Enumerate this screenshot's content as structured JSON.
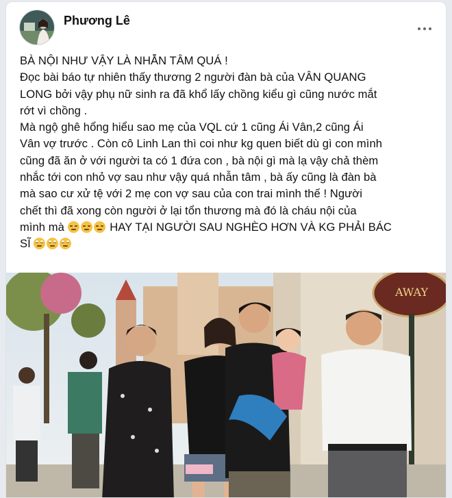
{
  "post": {
    "author": "Phương Lê",
    "avatar_icon": "profile-photo-icon",
    "more_icon": "more-options-icon",
    "text_lines": [
      "BÀ NỘI NHƯ VẬY LÀ NHẪN TÂM QUÁ !",
      "Đọc bài báo tự nhiên thấy thương 2 người đàn bà của VÂN QUANG",
      "LONG bởi vậy phụ nữ sinh ra đã khổ lấy chồng kiểu gì cũng nước mắt",
      "rớt vì chồng .",
      "Mà ngộ ghê hổng hiểu sao mẹ của VQL cứ 1 cũng Ái Vân,2 cũng Ái",
      "Vân vợ trước . Còn cô Linh Lan thì coi như kg quen biết dù gì con mình",
      "cũng đã ăn ở với người ta có 1 đứa con , bà nội gì mà lạ vậy chả thèm",
      "nhắc tới con nhỏ vợ sau như vậy quá nhẫn tâm , bà ấy cũng là đàn bà",
      "mà sao cư xử tệ với 2 mẹ con vợ sau của con trai mình thế ! Người",
      "chết thì đã xong còn người ở lại tổn thương mà đó là cháu nội của",
      "mình mà",
      "HAY TẠI NGƯỜI SAU NGHÈO HƠN VÀ KG PHẢI BÁC",
      "SĨ"
    ],
    "photo_sign_text": "AWAY"
  },
  "colors": {
    "background": "#e7eaef",
    "card": "#ffffff",
    "text": "#050505",
    "icon": "#65676b"
  }
}
